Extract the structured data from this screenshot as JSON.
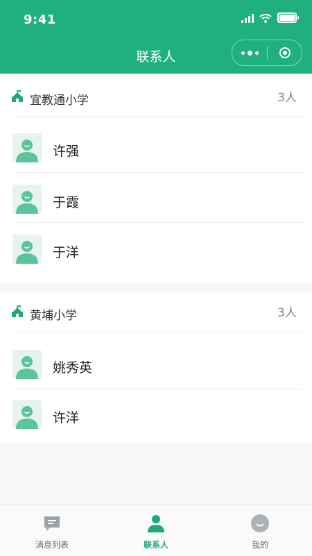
{
  "status_bar": {
    "time": "9:41"
  },
  "header": {
    "title": "联系人"
  },
  "colors": {
    "brand": "#20b07f",
    "tab_active": "#20a878",
    "avatar_bg": "#e6f3ee",
    "avatar_fg": "#5cc49a"
  },
  "groups": [
    {
      "name": "宜教通小学",
      "count": "3人",
      "contacts": [
        {
          "name": "许强"
        },
        {
          "name": "于霞"
        },
        {
          "name": "于洋"
        }
      ]
    },
    {
      "name": "黄埔小学",
      "count": "3人",
      "contacts": [
        {
          "name": "姚秀英"
        },
        {
          "name": "许洋"
        }
      ]
    }
  ],
  "tabbar": {
    "tabs": [
      {
        "label": "消息列表",
        "icon": "message-icon",
        "active": false
      },
      {
        "label": "联系人",
        "icon": "contacts-icon",
        "active": true
      },
      {
        "label": "我的",
        "icon": "profile-icon",
        "active": false
      }
    ]
  }
}
